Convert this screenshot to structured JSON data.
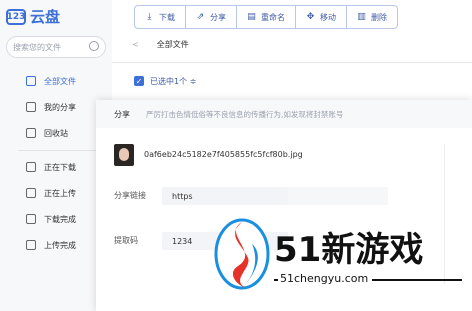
{
  "app": {
    "logo_mark": "123",
    "name": "云盘"
  },
  "sidebar": {
    "search_placeholder": "搜索您的文件",
    "items": [
      {
        "label": "全部文件",
        "icon": "folder-icon"
      },
      {
        "label": "我的分享",
        "icon": "share-icon"
      },
      {
        "label": "回收站",
        "icon": "trash-icon"
      },
      {
        "label": "正在下载",
        "icon": "download-icon"
      },
      {
        "label": "正在上传",
        "icon": "upload-icon"
      },
      {
        "label": "下载完成",
        "icon": "download-done-icon"
      },
      {
        "label": "上传完成",
        "icon": "upload-done-icon"
      }
    ]
  },
  "toolbar": {
    "download": "下载",
    "share": "分享",
    "rename": "重命名",
    "move": "移动",
    "delete": "删除"
  },
  "breadcrumb": {
    "back": "<",
    "current": "全部文件"
  },
  "selection": {
    "label": "已选中1个 ≑"
  },
  "modal": {
    "title": "分享",
    "notice": "严厉打击色情低俗等不良信息的传播行为,如发现将封禁账号",
    "filename": "0af6eb24c5182e7f405855fc5fcf80b.jpg",
    "share_link_label": "分享链接",
    "share_link_value": "https",
    "code_label": "提取码",
    "code_value": "1234"
  },
  "watermark": {
    "brand": "51新游戏",
    "url": "51chengyu.com"
  },
  "colors": {
    "accent": "#3c6fd8",
    "toolbar_text": "#3c5aa8"
  }
}
